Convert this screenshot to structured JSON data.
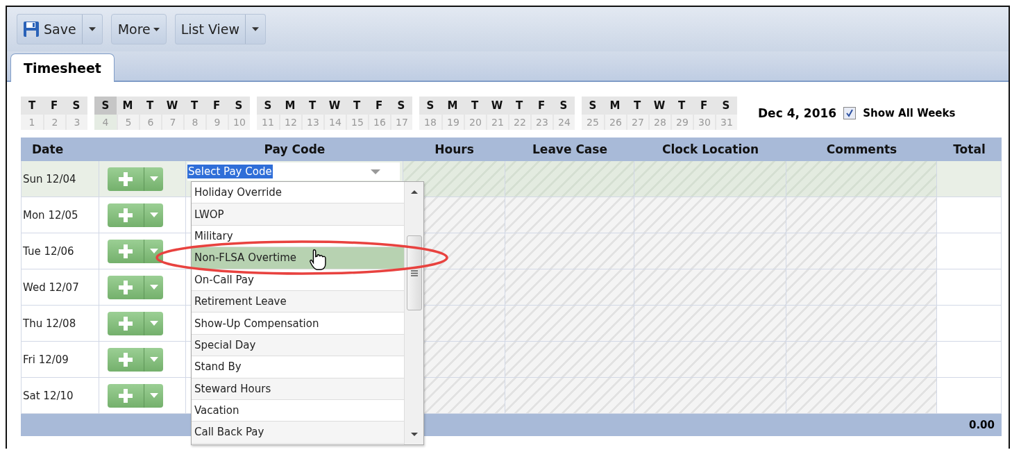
{
  "toolbar": {
    "buttons": [
      {
        "label": "Save",
        "kind": "save"
      },
      {
        "label": "More",
        "kind": "menu"
      },
      {
        "label": "List View",
        "kind": "split"
      }
    ]
  },
  "tabs": [
    {
      "label": "Timesheet",
      "selected": true
    }
  ],
  "calendar": {
    "weeks": [
      {
        "days": [
          {
            "letter": "T",
            "number": "1",
            "selected": false
          },
          {
            "letter": "F",
            "number": "2",
            "selected": false
          },
          {
            "letter": "S",
            "number": "3",
            "selected": false
          }
        ]
      },
      {
        "days": [
          {
            "letter": "S",
            "number": "4",
            "selected": true
          },
          {
            "letter": "M",
            "number": "5",
            "selected": false
          },
          {
            "letter": "T",
            "number": "6",
            "selected": false
          },
          {
            "letter": "W",
            "number": "7",
            "selected": false
          },
          {
            "letter": "T",
            "number": "8",
            "selected": false
          },
          {
            "letter": "F",
            "number": "9",
            "selected": false
          },
          {
            "letter": "S",
            "number": "10",
            "selected": false
          }
        ]
      },
      {
        "days": [
          {
            "letter": "S",
            "number": "11",
            "selected": false
          },
          {
            "letter": "M",
            "number": "12",
            "selected": false
          },
          {
            "letter": "T",
            "number": "13",
            "selected": false
          },
          {
            "letter": "W",
            "number": "14",
            "selected": false
          },
          {
            "letter": "T",
            "number": "15",
            "selected": false
          },
          {
            "letter": "F",
            "number": "16",
            "selected": false
          },
          {
            "letter": "S",
            "number": "17",
            "selected": false
          }
        ]
      },
      {
        "days": [
          {
            "letter": "S",
            "number": "18",
            "selected": false
          },
          {
            "letter": "M",
            "number": "19",
            "selected": false
          },
          {
            "letter": "T",
            "number": "20",
            "selected": false
          },
          {
            "letter": "W",
            "number": "21",
            "selected": false
          },
          {
            "letter": "T",
            "number": "22",
            "selected": false
          },
          {
            "letter": "F",
            "number": "23",
            "selected": false
          },
          {
            "letter": "S",
            "number": "24",
            "selected": false
          }
        ]
      },
      {
        "days": [
          {
            "letter": "S",
            "number": "25",
            "selected": false
          },
          {
            "letter": "M",
            "number": "26",
            "selected": false
          },
          {
            "letter": "T",
            "number": "27",
            "selected": false
          },
          {
            "letter": "W",
            "number": "28",
            "selected": false
          },
          {
            "letter": "T",
            "number": "29",
            "selected": false
          },
          {
            "letter": "F",
            "number": "30",
            "selected": false
          },
          {
            "letter": "S",
            "number": "31",
            "selected": false
          }
        ]
      }
    ],
    "date": "Dec 4, 2016",
    "show_all_weeks": {
      "label": "Show All Weeks",
      "checked": true
    }
  },
  "table": {
    "columns": [
      "Date",
      "Pay Code",
      "Hours",
      "Leave Case",
      "Clock Location",
      "Comments",
      "Total"
    ],
    "rows": [
      {
        "date": "Sun 12/04",
        "selected": true
      },
      {
        "date": "Mon 12/05",
        "selected": false
      },
      {
        "date": "Tue 12/06",
        "selected": false
      },
      {
        "date": "Wed 12/07",
        "selected": false
      },
      {
        "date": "Thu 12/08",
        "selected": false
      },
      {
        "date": "Fri 12/09",
        "selected": false
      },
      {
        "date": "Sat 12/10",
        "selected": false
      }
    ],
    "footer_total": "0.00"
  },
  "pay_code_dropdown": {
    "value": "Select Pay Code",
    "items": [
      {
        "label": "Holiday Override",
        "selected": false
      },
      {
        "label": "LWOP",
        "selected": false
      },
      {
        "label": "Military",
        "selected": false
      },
      {
        "label": "Non-FLSA Overtime",
        "selected": true
      },
      {
        "label": "On-Call Pay",
        "selected": false
      },
      {
        "label": "Retirement Leave",
        "selected": false
      },
      {
        "label": "Show-Up Compensation",
        "selected": false
      },
      {
        "label": "Special Day",
        "selected": false
      },
      {
        "label": "Stand By",
        "selected": false
      },
      {
        "label": "Steward Hours",
        "selected": false
      },
      {
        "label": "Vacation",
        "selected": false
      },
      {
        "label": "Call Back Pay",
        "selected": false
      }
    ]
  }
}
